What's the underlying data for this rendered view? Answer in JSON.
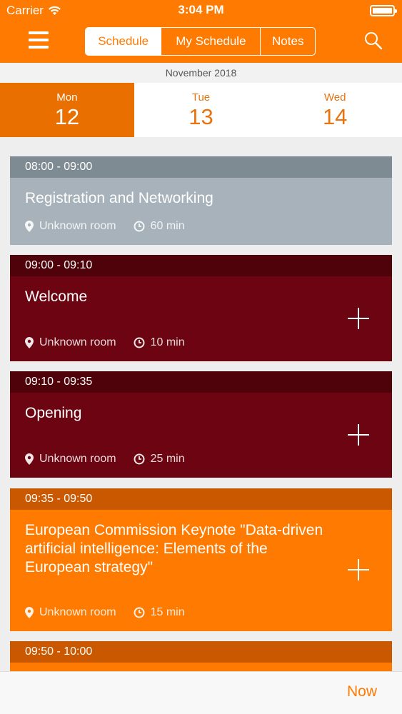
{
  "status_bar": {
    "carrier": "Carrier",
    "time": "3:04 PM"
  },
  "nav": {
    "segments": [
      {
        "label": "Schedule",
        "active": true
      },
      {
        "label": "My Schedule",
        "active": false
      },
      {
        "label": "Notes",
        "active": false
      }
    ]
  },
  "calendar": {
    "month": "November 2018",
    "days": [
      {
        "name": "Mon",
        "num": "12",
        "active": true
      },
      {
        "name": "Tue",
        "num": "13",
        "active": false
      },
      {
        "name": "Wed",
        "num": "14",
        "active": false
      }
    ]
  },
  "sessions": [
    {
      "time": "08:00 - 09:00",
      "title": "Registration and Networking",
      "room": "Unknown room",
      "duration": "60 min"
    },
    {
      "time": "09:00 - 09:10",
      "title": "Welcome",
      "room": "Unknown room",
      "duration": "10 min"
    },
    {
      "time": "09:10 - 09:35",
      "title": "Opening",
      "room": "Unknown room",
      "duration": "25 min"
    },
    {
      "time": "09:35 - 09:50",
      "title": "European Commission Keynote \"Data-driven artificial intelligence: Elements of the European strategy\"",
      "room": "Unknown room",
      "duration": "15 min"
    },
    {
      "time": "09:50 - 10:00"
    }
  ],
  "footer": {
    "now_label": "Now"
  },
  "colors": {
    "accent": "#ff7a00",
    "gray_card": "#a7b2ba",
    "gray_bar": "#7f8b93",
    "maroon_card": "#6c0511",
    "maroon_bar": "#4f0209",
    "orange_card": "#ff7a00",
    "orange_bar": "#c95800"
  }
}
